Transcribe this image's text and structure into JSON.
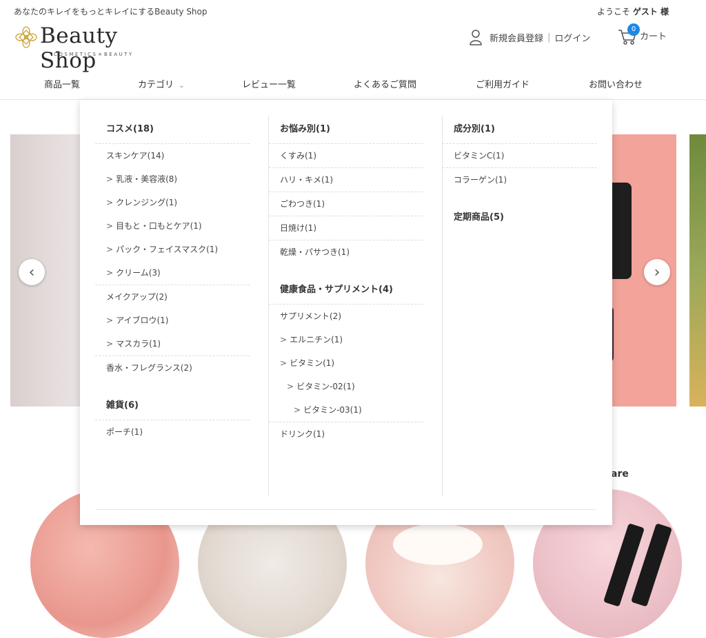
{
  "header": {
    "tagline": "あなたのキレイをもっとキレイにするBeauty Shop",
    "welcome_prefix": "ようこそ",
    "welcome_name": "ゲスト 様",
    "logo_text": "Beauty Shop",
    "logo_sub": "COSMETICS＊BEAUTY",
    "register": "新規会員登録",
    "login": "ログイン",
    "cart_label": "カート",
    "cart_count": "0",
    "badge_color": "#1e88e5"
  },
  "nav": {
    "items": [
      "商品一覧",
      "カテゴリ",
      "レビュー一覧",
      "よくあるご質問",
      "ご利用ガイド",
      "お問い合わせ"
    ]
  },
  "mega": {
    "col1": {
      "heading": "コスメ(18)",
      "skincare": "スキンケア(14)",
      "skincare_children": [
        "乳液・美容液(8)",
        "クレンジング(1)",
        "目もと・口もとケア(1)",
        "パック・フェイスマスク(1)",
        "クリーム(3)"
      ],
      "makeup": "メイクアップ(2)",
      "makeup_children": [
        "アイブロウ(1)",
        "マスカラ(1)"
      ],
      "fragrance": "香水・フレグランス(2)",
      "zakka_heading": "雑貨(6)",
      "zakka_items": [
        "ポーチ(1)"
      ]
    },
    "col2": {
      "heading": "お悩み別(1)",
      "items": [
        "くすみ(1)",
        "ハリ・キメ(1)",
        "ごわつき(1)",
        "日焼け(1)",
        "乾燥・パサつき(1)"
      ],
      "health_heading": "健康食品・サプリメント(4)",
      "supplement": "サプリメント(2)",
      "ergo": "エルニチン(1)",
      "vitamin": "ビタミン(1)",
      "vitamin02": "ビタミン-02(1)",
      "vitamin03": "ビタミン-03(1)",
      "drink": "ドリンク(1)"
    },
    "col3": {
      "heading": "成分別(1)",
      "items": [
        "ビタミンC(1)",
        "コラーゲン(1)"
      ],
      "teiki_heading": "定期商品(5)"
    }
  },
  "background": {
    "section_word": "are",
    "prev_icon": "chevron-left-icon",
    "next_icon": "chevron-right-icon"
  }
}
